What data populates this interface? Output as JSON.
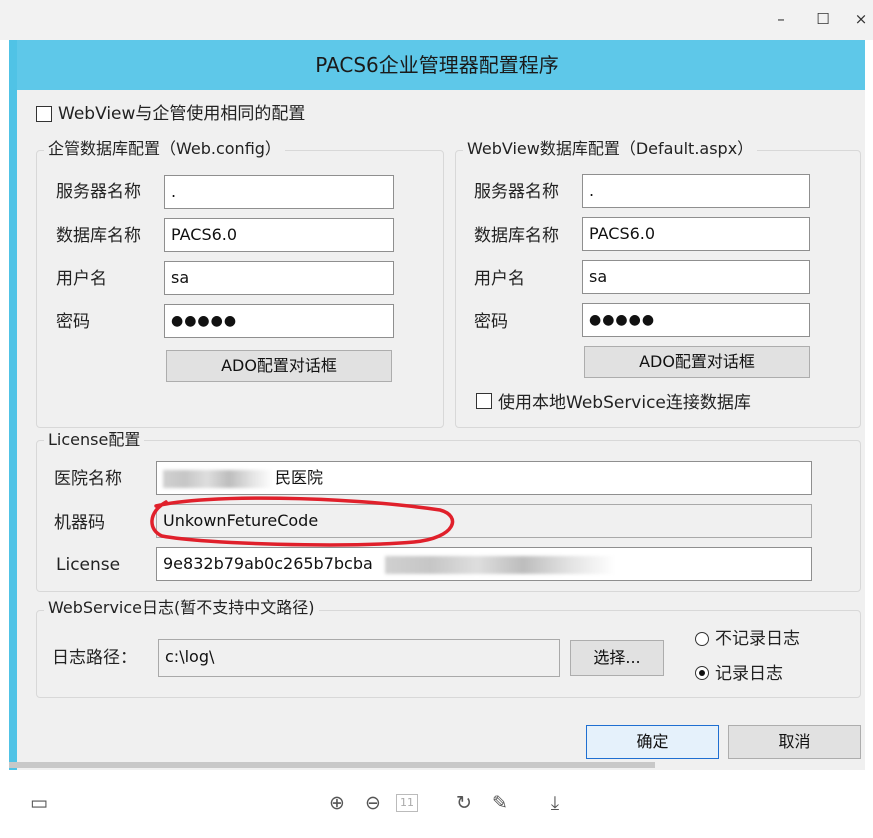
{
  "window": {
    "minimize": "–",
    "maximize": "☐",
    "close": "×"
  },
  "title": "PACS6企业管理器配置程序",
  "same_config_label": "WebView与企管使用相同的配置",
  "enterprise_db": {
    "legend": "企管数据库配置（Web.config）",
    "server_label": "服务器名称",
    "server_value": ".",
    "db_label": "数据库名称",
    "db_value": "PACS6.0",
    "user_label": "用户名",
    "user_value": "sa",
    "pwd_label": "密码",
    "pwd_value": "●●●●●",
    "ado_button": "ADO配置对话框"
  },
  "webview_db": {
    "legend": "WebView数据库配置（Default.aspx）",
    "server_label": "服务器名称",
    "server_value": ".",
    "db_label": "数据库名称",
    "db_value": "PACS6.0",
    "user_label": "用户名",
    "user_value": "sa",
    "pwd_label": "密码",
    "pwd_value": "●●●●●",
    "ado_button": "ADO配置对话框",
    "local_ws_label": "使用本地WebService连接数据库"
  },
  "license": {
    "legend": "License配置",
    "hospital_label": "医院名称",
    "hospital_value": "民医院",
    "machine_label": "机器码",
    "machine_value": "UnkownFetureCode",
    "license_label": "License",
    "license_value": "9e832b79ab0c265b7bcba"
  },
  "log": {
    "legend": "WebService日志(暂不支持中文路径)",
    "path_label": "日志路径：",
    "path_value": "c:\\log\\",
    "choose_button": "选择...",
    "no_log_label": "不记录日志",
    "log_label": "记录日志"
  },
  "buttons": {
    "ok": "确定",
    "cancel": "取消"
  },
  "toolbar": {
    "layout": "▭",
    "zoom_in": "⊕",
    "zoom_out": "⊖",
    "fit": "11",
    "rotate": "↻",
    "edit": "✎",
    "download": "⤓"
  },
  "colors": {
    "header": "#5ec8e9",
    "annotation": "#e0202b"
  }
}
